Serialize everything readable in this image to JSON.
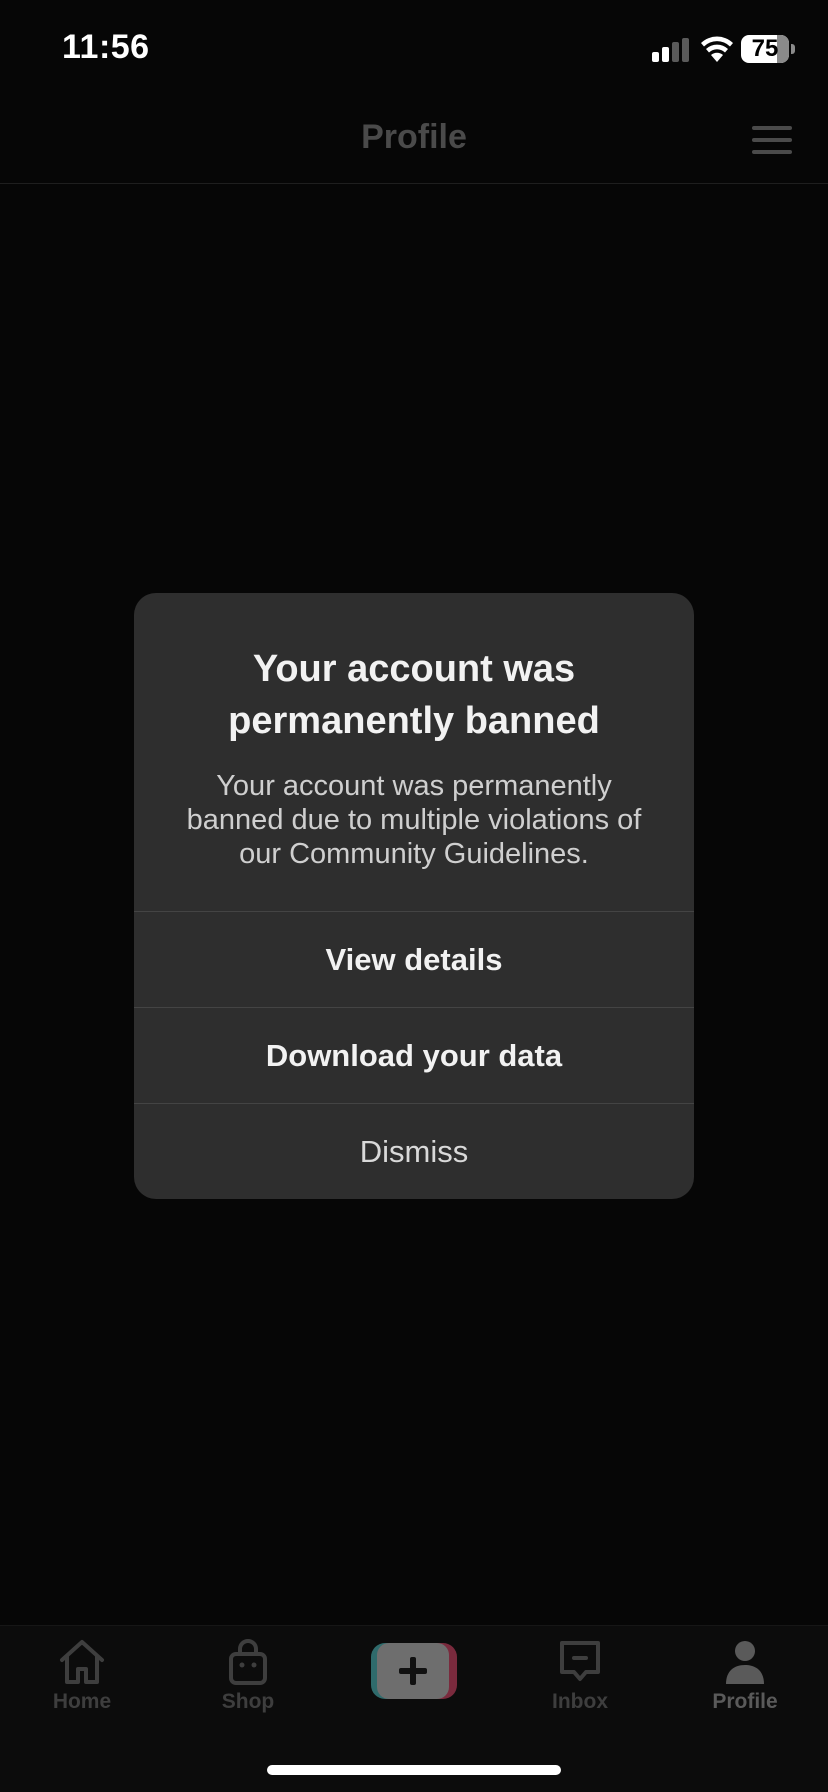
{
  "status_bar": {
    "time": "11:56",
    "battery_level": "75"
  },
  "header": {
    "title": "Profile"
  },
  "modal": {
    "title": "Your account was permanently banned",
    "body": "Your account was permanently banned due to multiple violations of our Community Guidelines.",
    "actions": [
      {
        "label": "View details"
      },
      {
        "label": "Download your data"
      },
      {
        "label": "Dismiss"
      }
    ]
  },
  "bottom_nav": {
    "items": [
      {
        "label": "Home",
        "icon": "home-icon"
      },
      {
        "label": "Shop",
        "icon": "shopping-bag-icon"
      },
      {
        "label": "",
        "icon": "plus-icon"
      },
      {
        "label": "Inbox",
        "icon": "inbox-icon"
      },
      {
        "label": "Profile",
        "icon": "person-icon"
      }
    ],
    "active": "Profile"
  },
  "colors": {
    "background": "#060606",
    "modal_background": "#2e2e2e",
    "dimmed_text": "#4a4a4a"
  }
}
